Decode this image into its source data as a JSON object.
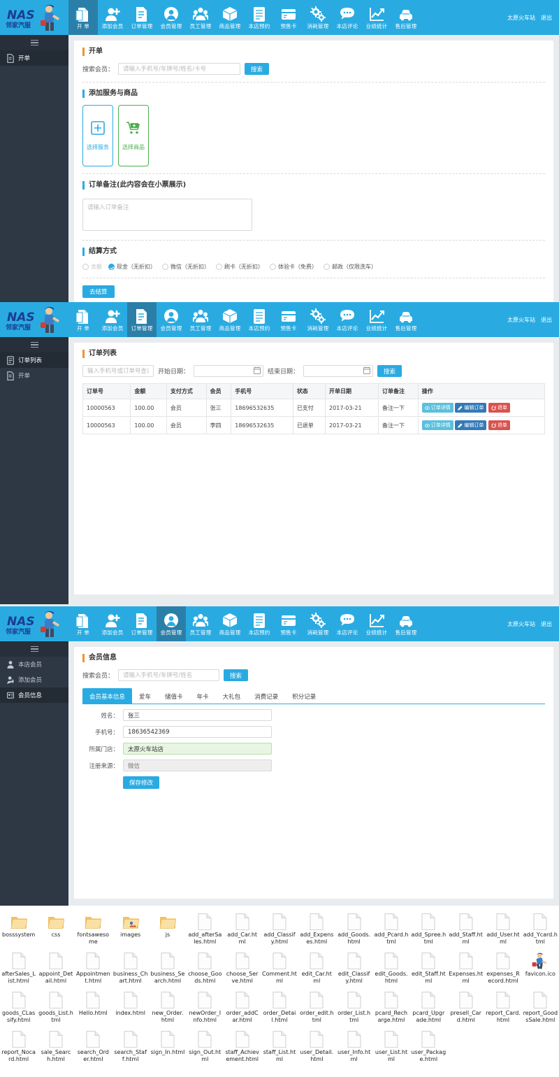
{
  "brand": {
    "name": "NAS",
    "subtitle": "邻家汽服"
  },
  "topnav": {
    "items": [
      {
        "label": "开 单",
        "icon": "file-add-icon",
        "active_panels": [
          1
        ]
      },
      {
        "label": "添加会员",
        "icon": "user-plus-icon"
      },
      {
        "label": "订单管理",
        "icon": "document-icon"
      },
      {
        "label": "会员管理",
        "icon": "user-circle-icon"
      },
      {
        "label": "员工管理",
        "icon": "users-group-icon"
      },
      {
        "label": "商品管理",
        "icon": "box-icon"
      },
      {
        "label": "本店预约",
        "icon": "calendar-icon"
      },
      {
        "label": "预售卡",
        "icon": "card-icon"
      },
      {
        "label": "消耗管理",
        "icon": "gears-icon"
      },
      {
        "label": "本店评论",
        "icon": "comment-icon"
      },
      {
        "label": "业绩统计",
        "icon": "chart-line-icon"
      },
      {
        "label": "售后管理",
        "icon": "car-icon"
      }
    ],
    "store": "太原火车站",
    "logout": "退出"
  },
  "panel1": {
    "active_nav": 0,
    "sidebar": [
      {
        "label": "开单",
        "icon": "file-icon",
        "active": true
      }
    ],
    "title": "开单",
    "search_label": "搜索会员：",
    "search_placeholder": "请输入手机号/车牌号/姓名/卡号",
    "search_button": "搜索",
    "add_section_title": "添加服务与商品",
    "choose_service": "选择服务",
    "choose_goods": "选择商品",
    "remark_title": "订单备注(此内容会在小票展示)",
    "remark_placeholder": "请输入订单备注",
    "pay_title": "结算方式",
    "pay_options": [
      {
        "label": "余额",
        "checked": false,
        "disabled": true
      },
      {
        "label": "现金（无折扣）",
        "checked": true,
        "disabled": false
      },
      {
        "label": "微信（无折扣）",
        "checked": false,
        "disabled": false
      },
      {
        "label": "刷卡（无折扣）",
        "checked": false,
        "disabled": false
      },
      {
        "label": "体验卡（免费）",
        "checked": false,
        "disabled": false
      },
      {
        "label": "邮政（仅限洗车）",
        "checked": false,
        "disabled": false
      }
    ],
    "submit_button": "去结算"
  },
  "panel2": {
    "active_nav": 2,
    "sidebar": [
      {
        "label": "订单列表",
        "icon": "list-icon",
        "active": true
      },
      {
        "label": "开单",
        "icon": "file-icon",
        "active": false
      }
    ],
    "title": "订单列表",
    "search_placeholder": "输入手机号或订单号查询",
    "start_date_label": "开始日期：",
    "start_date_value": "",
    "end_date_label": "结束日期：",
    "end_date_value": "",
    "search_button": "搜索",
    "table": {
      "headers": [
        "订单号",
        "金额",
        "支付方式",
        "会员",
        "手机号",
        "状态",
        "开单日期",
        "订单备注",
        "操作"
      ],
      "rows": [
        {
          "order_no": "10000563",
          "amount": "100.00",
          "pay_type": "会员",
          "member": "张三",
          "phone": "18696532635",
          "status": "已支付",
          "date": "2017-03-21",
          "remark": "备注一下"
        },
        {
          "order_no": "10000563",
          "amount": "100.00",
          "pay_type": "会员",
          "member": "李四",
          "phone": "18696532635",
          "status": "已退单",
          "date": "2017-03-21",
          "remark": "备注一下"
        }
      ],
      "actions": {
        "detail": "订单详情",
        "edit": "编辑订单",
        "refund": "退单"
      }
    }
  },
  "panel3": {
    "active_nav": 3,
    "sidebar": [
      {
        "label": "本店会员",
        "icon": "user-icon",
        "active": false
      },
      {
        "label": "添加会员",
        "icon": "user-plus-icon",
        "active": false
      },
      {
        "label": "会员信息",
        "icon": "id-card-icon",
        "active": true
      }
    ],
    "title": "会员信息",
    "search_label": "搜索会员：",
    "search_placeholder": "请输入手机号/车牌号/姓名",
    "search_button": "搜索",
    "tabs": [
      "会员基本信息",
      "爱车",
      "储值卡",
      "年卡",
      "大礼包",
      "消费记录",
      "积分记录"
    ],
    "active_tab": 0,
    "form": [
      {
        "label": "姓名：",
        "value": "张三",
        "style": "normal"
      },
      {
        "label": "手机号：",
        "value": "18636542369",
        "style": "normal"
      },
      {
        "label": "所属门店：",
        "value": "太原火车站店",
        "style": "green"
      },
      {
        "label": "注册来源：",
        "value": "微信",
        "style": "grey"
      }
    ],
    "save_button": "保存修改"
  },
  "explorer": {
    "files": [
      {
        "name": "bosssystem",
        "type": "folder"
      },
      {
        "name": "css",
        "type": "folder"
      },
      {
        "name": "fontsawesome",
        "type": "folder"
      },
      {
        "name": "images",
        "type": "folder-img"
      },
      {
        "name": "js",
        "type": "folder"
      },
      {
        "name": "add_afterSales.html",
        "type": "file"
      },
      {
        "name": "add_Car.html",
        "type": "file"
      },
      {
        "name": "add_Classify.html",
        "type": "file"
      },
      {
        "name": "add_Expenses.html",
        "type": "file"
      },
      {
        "name": "add_Goods.html",
        "type": "file"
      },
      {
        "name": "add_Pcard.html",
        "type": "file"
      },
      {
        "name": "add_Spree.html",
        "type": "file"
      },
      {
        "name": "add_Staff.html",
        "type": "file"
      },
      {
        "name": "add_User.html",
        "type": "file"
      },
      {
        "name": "add_Ycard.html",
        "type": "file"
      },
      {
        "name": "afterSales_List.html",
        "type": "file"
      },
      {
        "name": "appoint_Detail.html",
        "type": "file"
      },
      {
        "name": "Appointment.html",
        "type": "file"
      },
      {
        "name": "business_Chart.html",
        "type": "file"
      },
      {
        "name": "business_Search.html",
        "type": "file"
      },
      {
        "name": "choose_Goods.html",
        "type": "file"
      },
      {
        "name": "choose_Serve.html",
        "type": "file"
      },
      {
        "name": "Comment.html",
        "type": "file"
      },
      {
        "name": "edit_Car.html",
        "type": "file"
      },
      {
        "name": "edit_Classify.html",
        "type": "file"
      },
      {
        "name": "edit_Goods.html",
        "type": "file"
      },
      {
        "name": "edit_Staff.html",
        "type": "file"
      },
      {
        "name": "Expenses.html",
        "type": "file"
      },
      {
        "name": "expenses_Record.html",
        "type": "file"
      },
      {
        "name": "favicon.ico",
        "type": "ico"
      },
      {
        "name": "goods_CLassify.html",
        "type": "file"
      },
      {
        "name": "goods_List.html",
        "type": "file"
      },
      {
        "name": "Hello.html",
        "type": "file"
      },
      {
        "name": "index.html",
        "type": "file"
      },
      {
        "name": "new_Order.html",
        "type": "file"
      },
      {
        "name": "newOrder_Info.html",
        "type": "file"
      },
      {
        "name": "order_addCar.html",
        "type": "file"
      },
      {
        "name": "order_Detail.html",
        "type": "file"
      },
      {
        "name": "order_edit.html",
        "type": "file"
      },
      {
        "name": "order_List.html",
        "type": "file"
      },
      {
        "name": "pcard_Recharge.html",
        "type": "file"
      },
      {
        "name": "pcard_Upgrade.html",
        "type": "file"
      },
      {
        "name": "presell_Card.html",
        "type": "file"
      },
      {
        "name": "report_Card.html",
        "type": "file"
      },
      {
        "name": "report_GoodsSale.html",
        "type": "file"
      },
      {
        "name": "report_Nocard.html",
        "type": "file"
      },
      {
        "name": "sale_Search.html",
        "type": "file"
      },
      {
        "name": "search_Order.html",
        "type": "file"
      },
      {
        "name": "search_Staff.html",
        "type": "file"
      },
      {
        "name": "sign_In.html",
        "type": "file"
      },
      {
        "name": "sign_Out.html",
        "type": "file"
      },
      {
        "name": "staff_Achievement.html",
        "type": "file"
      },
      {
        "name": "staff_List.html",
        "type": "file"
      },
      {
        "name": "user_Detail.html",
        "type": "file"
      },
      {
        "name": "user_Info.html",
        "type": "file"
      },
      {
        "name": "user_List.html",
        "type": "file"
      },
      {
        "name": "user_Package.html",
        "type": "file"
      }
    ]
  },
  "colors": {
    "accent": "#29ABE2",
    "sidebar": "#2e3744",
    "orange": "#f0932b",
    "green": "#4caf50",
    "danger": "#d9534f"
  }
}
